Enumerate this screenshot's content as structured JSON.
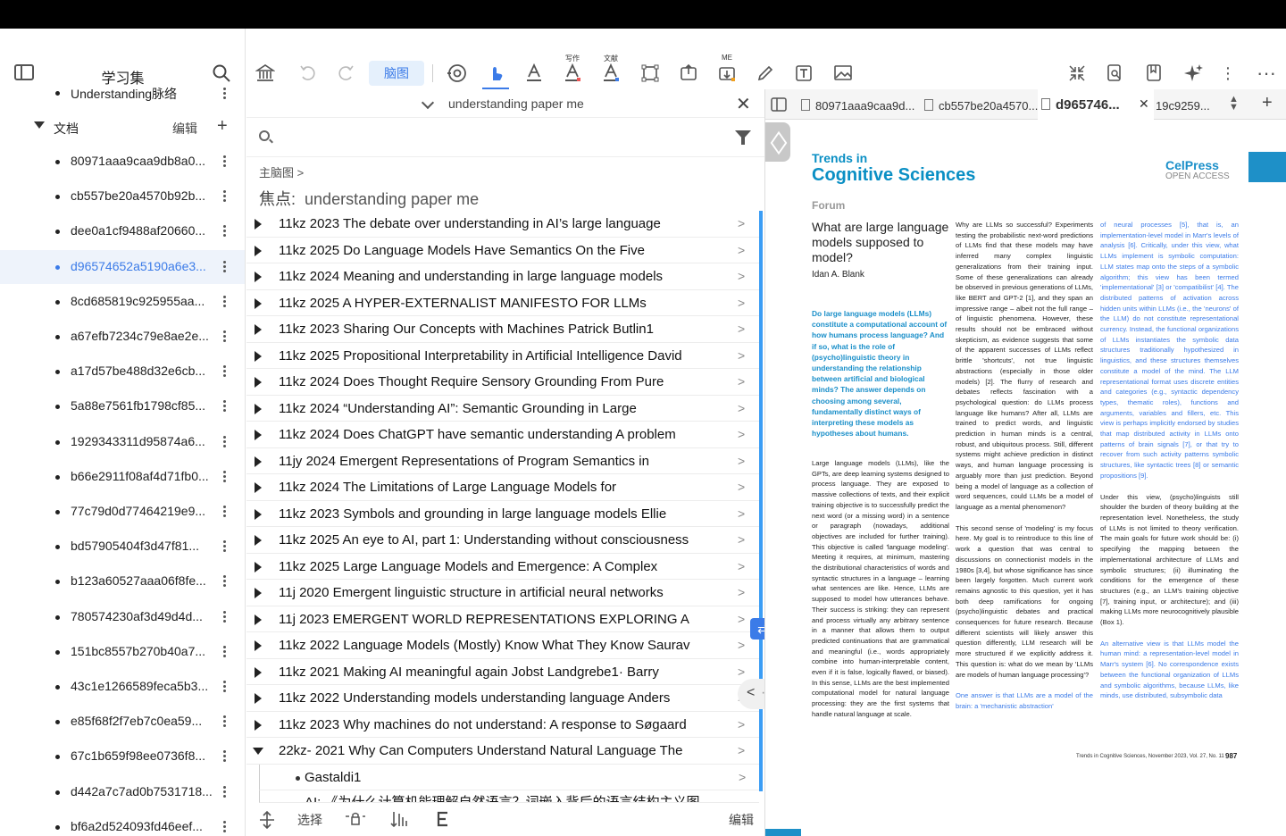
{
  "sidebar": {
    "title": "学习集",
    "partial_item": "Understanding脉络",
    "folder": {
      "label": "文档",
      "edit": "编辑",
      "plus": "+"
    },
    "items": [
      {
        "label": "80971aaa9caa9db8a0..."
      },
      {
        "label": "cb557be20a4570b92b..."
      },
      {
        "label": "dee0a1cf9488af20660..."
      },
      {
        "label": "d96574652a5190a6e3...",
        "active": true
      },
      {
        "label": "8cd685819c925955aa..."
      },
      {
        "label": "a67efb7234c79e8ae2e..."
      },
      {
        "label": "a17d57be488d32e6cb..."
      },
      {
        "label": "5a88e7561fb1798cf85..."
      },
      {
        "label": "1929343311d95874a6..."
      },
      {
        "label": "b66e2911f08af4d71fb0..."
      },
      {
        "label": "77c79d0d77464219e9..."
      },
      {
        "label": "bd57905404f3d47f81..."
      },
      {
        "label": "b123a60527aaa06f8fe..."
      },
      {
        "label": "780574230af3d49d4d..."
      },
      {
        "label": "151bc8557b270b40a7..."
      },
      {
        "label": "43c1e1266589feca5b3..."
      },
      {
        "label": "e85f68f2f7eb7c0ea59..."
      },
      {
        "label": "67c1b659f98ee0736f8..."
      },
      {
        "label": "d442a7c7ad0b7531718..."
      },
      {
        "label": "bf6a2d524093fd46eef..."
      }
    ]
  },
  "toolbar": {
    "mindmap_label": "脑图",
    "write_label": "写作",
    "literature_label": "文献",
    "me_label": "ME"
  },
  "outline": {
    "title": "understanding paper me",
    "breadcrumb": "主脑图 >",
    "focus_prefix": "焦点:",
    "focus_value": "understanding paper me",
    "rows": [
      "11kz 2023 The debate over understanding in AI’s large language",
      "11kz 2025 Do Language Models Have Semantics On the Five",
      "11kz 2024 Meaning and understanding in large language models",
      "11kz 2025 A HYPER-EXTERNALIST MANIFESTO FOR LLMs",
      "11kz 2023 Sharing Our Concepts with Machines Patrick Butlin1",
      "11kz 2025 Propositional Interpretability in Artificial Intelligence David",
      "11kz 2024 Does Thought Require Sensory Grounding  From Pure",
      "11kz 2024 “Understanding AI”: Semantic Grounding in Large",
      "11kz 2024 Does ChatGPT have semantic understanding A problem",
      "11jy 2024 Emergent Representations of Program Semantics in",
      "11kz 2024 The Limitations of Large Language Models for",
      "11kz 2023 Symbols and grounding in large language models Ellie",
      "11kz 2025 An eye to AI, part 1: Understanding without consciousness",
      "11kz 2025 Large Language Models and Emergence: A Complex",
      "11j 2020 Emergent linguistic structure in artificial neural networks",
      "11j 2023 EMERGENT WORLD REPRESENTATIONS EXPLORING A",
      "11kz 2022 Language Models (Mostly) Know What They Know Saurav",
      "11kz 2021 Making AI meaningful again Jobst Landgrebe1· Barry",
      "11kz 2022 Understanding models understanding language Anders",
      "11kz 2023 Why machines do not understand: A response to Søgaard",
      "22kz- 2021 Why Can Computers Understand Natural Language The"
    ],
    "child_row": "Gastaldi1",
    "partial_row": "AI: 《为什么计算机能理解自然语言？词嵌入背后的语言结构主义图",
    "bottom": {
      "select": "选择",
      "edit": "编辑"
    }
  },
  "pdf": {
    "tabs": [
      {
        "label": "80971aaa9caa9d..."
      },
      {
        "label": "cb557be20a4570..."
      },
      {
        "label": "d965746...",
        "active": true
      },
      {
        "label": "19c9259..."
      }
    ],
    "journal_line1": "Trends in",
    "journal_line2": "Cognitive Sciences",
    "publisher": "CelPress",
    "publisher_sub": "OPEN ACCESS",
    "section": "Forum",
    "title": "What are large language models supposed to model?",
    "author": "Idan A. Blank",
    "abstract": "Do large language models (LLMs) constitute a computational account of how humans process language? And if so, what is the role of (psycho)linguistic theory in understanding the relationship between artificial and biological minds? The answer depends on choosing among several, fundamentally distinct ways of interpreting these models as hypotheses about humans.",
    "col1_body": "Large language models (LLMs), like the GPTs, are deep learning systems designed to process language. They are exposed to massive collections of texts, and their explicit training objective is to successfully predict the next word (or a missing word) in a sentence or paragraph (nowadays, additional objectives are included for further training). This objective is called 'language modeling'. Meeting it requires, at minimum, mastering the distributional characteristics of words and syntactic structures in a language – learning what sentences are like. Hence, LLMs are supposed to model how utterances behave. Their success is striking: they can represent and process virtually any arbitrary sentence in a manner that allows them to output predicted continuations that are grammatical and meaningful (i.e., words appropriately combine into human-interpretable content, even if it is false, logically flawed, or biased). In this sense, LLMs are the best implemented computational model for natural language processing: they are the first systems that handle natural language at scale.",
    "col2_body": "Why are LLMs so successful? Experiments testing the probabilistic next-word predictions of LLMs find that these models may have inferred many complex linguistic generalizations from their training input. Some of these generalizations can already be observed in previous generations of LLMs, like BERT and GPT-2 [1], and they span an impressive range – albeit not the full range – of linguistic phenomena. However, these results should not be embraced without skepticism, as evidence suggests that some of the apparent successes of LLMs reflect brittle 'shortcuts', not true linguistic abstractions (especially in those older models) [2]. The flurry of research and debates reflects fascination with a psychological question: do LLMs process language like humans? After all, LLMs are trained to predict words, and linguistic prediction in human minds is a central, robust, and ubiquitous process. Still, different systems might achieve prediction in distinct ways, and human language processing is arguably more than just prediction. Beyond being a model of language as a collection of word sequences, could LLMs be a model of language as a mental phenomenon?",
    "col2_body_b": "This second sense of 'modeling' is my focus here. My goal is to reintroduce to this line of work a question that was central to discussions on connectionist models in the 1980s [3,4], but whose significance has since been largely forgotten. Much current work remains agnostic to this question, yet it has both deep ramifications for ongoing (psycho)linguistic debates and practical consequences for future research. Because different scientists will likely answer this question differently, LLM research will be more structured if we explicitly address it. This question is: what do we mean by 'LLMs are models of human language processing'?",
    "col2_body_c": "One answer is that LLMs are a model of the brain: a 'mechanistic abstraction'",
    "col3_body": "of neural processes [5], that is, an implementation-level model in Marr's levels of analysis [6]. Critically, under this view, what LLMs implement is symbolic computation: LLM states map onto the steps of a symbolic algorithm; this view has been termed 'implementational' [3] or 'compatibilist' [4]. The distributed patterns of activation across hidden units within LLMs (i.e., the 'neurons' of the LLM) do not constitute representational currency. Instead, the functional organizations of LLMs instantiates the symbolic data structures traditionally hypothesized in linguistics, and these structures themselves constitute a model of the mind. The LLM representational format uses discrete entities and categories (e.g., syntactic dependency types, thematic roles), functions and arguments, variables and fillers, etc. This view is perhaps implicitly endorsed by studies that map distributed activity in LLMs onto patterns of brain signals [7], or that try to recover from such activity patterns symbolic structures, like syntactic trees [8] or semantic propositions [9].",
    "col3_body_b": "Under this view, (psycho)linguists still shoulder the burden of theory building at the representation level. Nonetheless, the study of LLMs is not limited to theory verification. The main goals for future work should be: (i) specifying the mapping between the implementational architecture of LLMs and symbolic structures; (ii) illuminating the conditions for the emergence of these structures (e.g., an LLM's training objective [7], training input, or architecture); and (iii) making LLMs more neurocognitively plausible (Box 1).",
    "col3_body_c": "An alternative view is that LLMs model the human mind: a representation-level model in Marr's system [6]. No correspondence exists between the functional organization of LLMs and symbolic algorithms, because LLMs, like minds, use distributed, subsymbolic data",
    "footer": "Trends in Cognitive Sciences, November 2023, Vol. 27, No. 11",
    "page_number": "987"
  },
  "colors": {
    "accent": "#3b7be8",
    "journal": "#0a8fc4",
    "scroll": "#3b9df5"
  }
}
